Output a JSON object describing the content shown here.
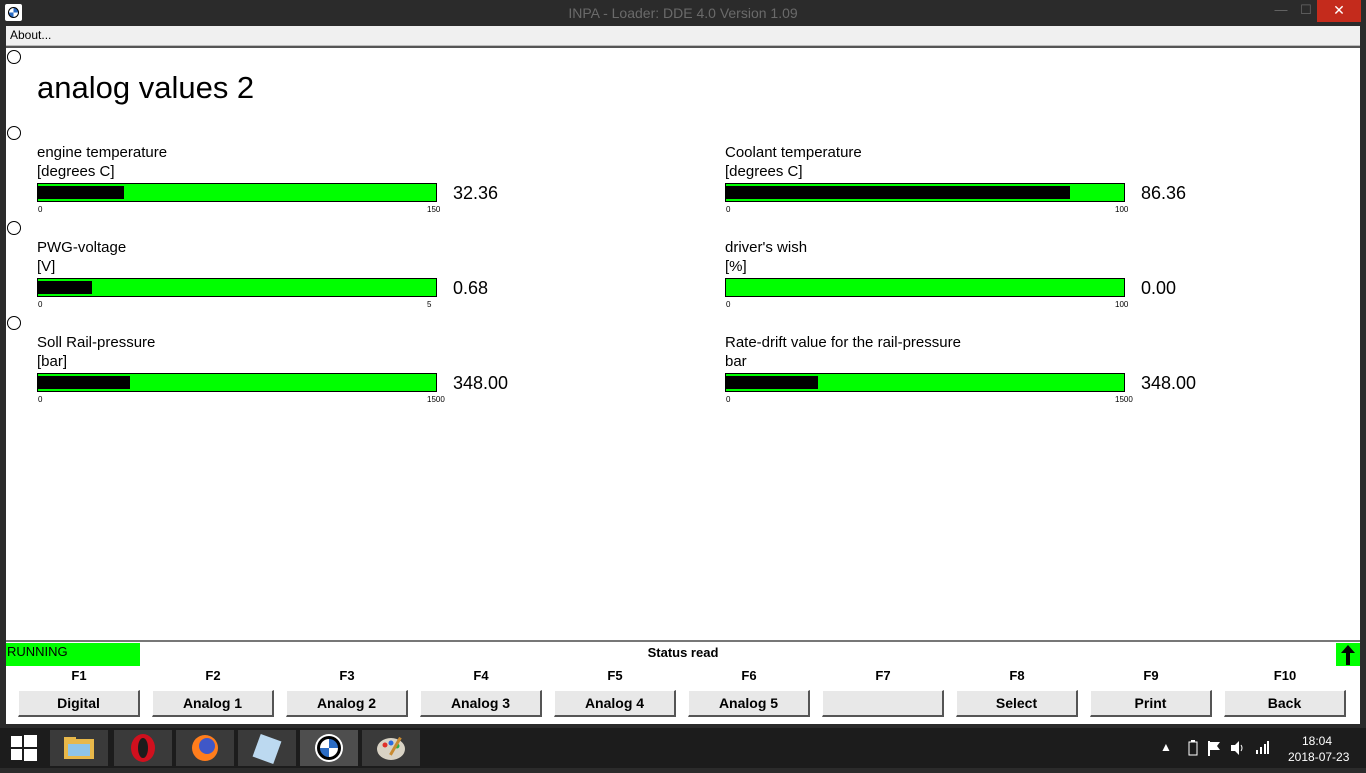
{
  "window": {
    "title": "INPA - Loader:  DDE 4.0 Version 1.09",
    "min_label": "—",
    "max_label": "☐",
    "close_label": "✕"
  },
  "menu": {
    "about": "About..."
  },
  "page": {
    "title": "analog values 2"
  },
  "gauges": [
    {
      "label": "engine temperature",
      "unit": "[degrees C]",
      "value": "32.36",
      "min": "0",
      "max": "150",
      "fraction": 0.2157
    },
    {
      "label": "Coolant temperature",
      "unit": "[degrees C]",
      "value": "86.36",
      "min": "0",
      "max": "100",
      "fraction": 0.8636
    },
    {
      "label": "PWG-voltage",
      "unit": "[V]",
      "value": "0.68",
      "min": "0",
      "max": "5",
      "fraction": 0.136
    },
    {
      "label": "driver's wish",
      "unit": "[%]",
      "value": "0.00",
      "min": "0",
      "max": "100",
      "fraction": 0.0
    },
    {
      "label": "Soll Rail-pressure",
      "unit": "[bar]",
      "value": "348.00",
      "min": "0",
      "max": "1500",
      "fraction": 0.232
    },
    {
      "label": "Rate-drift value for the rail-pressure",
      "unit": "bar",
      "value": "348.00",
      "min": "0",
      "max": "1500",
      "fraction": 0.232
    }
  ],
  "status": {
    "state": "RUNNING",
    "message": "Status read"
  },
  "fkeys": [
    {
      "key": "F1",
      "label": "Digital"
    },
    {
      "key": "F2",
      "label": "Analog 1"
    },
    {
      "key": "F3",
      "label": "Analog 2"
    },
    {
      "key": "F4",
      "label": "Analog 3"
    },
    {
      "key": "F5",
      "label": "Analog 4"
    },
    {
      "key": "F6",
      "label": "Analog 5"
    },
    {
      "key": "F7",
      "label": ""
    },
    {
      "key": "F8",
      "label": "Select"
    },
    {
      "key": "F9",
      "label": "Print"
    },
    {
      "key": "F10",
      "label": "Back"
    }
  ],
  "taskbar": {
    "apps": [
      "windows-start",
      "file-explorer",
      "opera",
      "firefox",
      "notepad",
      "inpa-bmw",
      "paint"
    ],
    "time": "18:04",
    "date": "2018-07-23"
  },
  "colors": {
    "gauge_bar": "#00ff00",
    "gauge_fill": "#000000",
    "running": "#00ff00"
  }
}
